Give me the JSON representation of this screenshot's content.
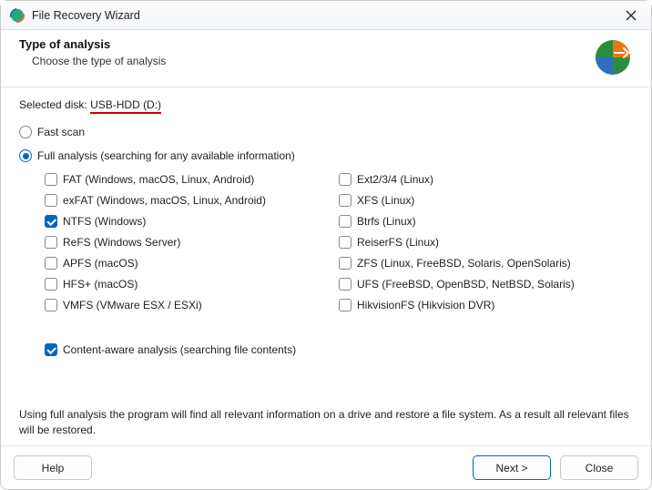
{
  "window": {
    "title": "File Recovery Wizard"
  },
  "header": {
    "title": "Type of analysis",
    "subtitle": "Choose the type of analysis"
  },
  "selected_disk": {
    "label": "Selected disk:",
    "value": "USB-HDD (D:)"
  },
  "scan_modes": {
    "fast": {
      "label": "Fast scan",
      "selected": false
    },
    "full": {
      "label": "Full analysis (searching for any available information)",
      "selected": true
    }
  },
  "filesystems": {
    "left": [
      {
        "label": "FAT (Windows, macOS, Linux, Android)",
        "checked": false
      },
      {
        "label": "exFAT (Windows, macOS, Linux, Android)",
        "checked": false
      },
      {
        "label": "NTFS (Windows)",
        "checked": true
      },
      {
        "label": "ReFS (Windows Server)",
        "checked": false
      },
      {
        "label": "APFS (macOS)",
        "checked": false
      },
      {
        "label": "HFS+ (macOS)",
        "checked": false
      },
      {
        "label": "VMFS (VMware ESX / ESXi)",
        "checked": false
      }
    ],
    "right": [
      {
        "label": "Ext2/3/4 (Linux)",
        "checked": false
      },
      {
        "label": "XFS (Linux)",
        "checked": false
      },
      {
        "label": "Btrfs (Linux)",
        "checked": false
      },
      {
        "label": "ReiserFS (Linux)",
        "checked": false
      },
      {
        "label": "ZFS (Linux, FreeBSD, Solaris, OpenSolaris)",
        "checked": false
      },
      {
        "label": "UFS (FreeBSD, OpenBSD, NetBSD, Solaris)",
        "checked": false
      },
      {
        "label": "HikvisionFS (Hikvision DVR)",
        "checked": false
      }
    ]
  },
  "content_aware": {
    "label": "Content-aware analysis (searching file contents)",
    "checked": true
  },
  "description": "Using full analysis the program will find all relevant information on a drive and restore a file system. As a result all relevant files will be restored.",
  "footer": {
    "help": "Help",
    "next": "Next >",
    "close": "Close"
  }
}
